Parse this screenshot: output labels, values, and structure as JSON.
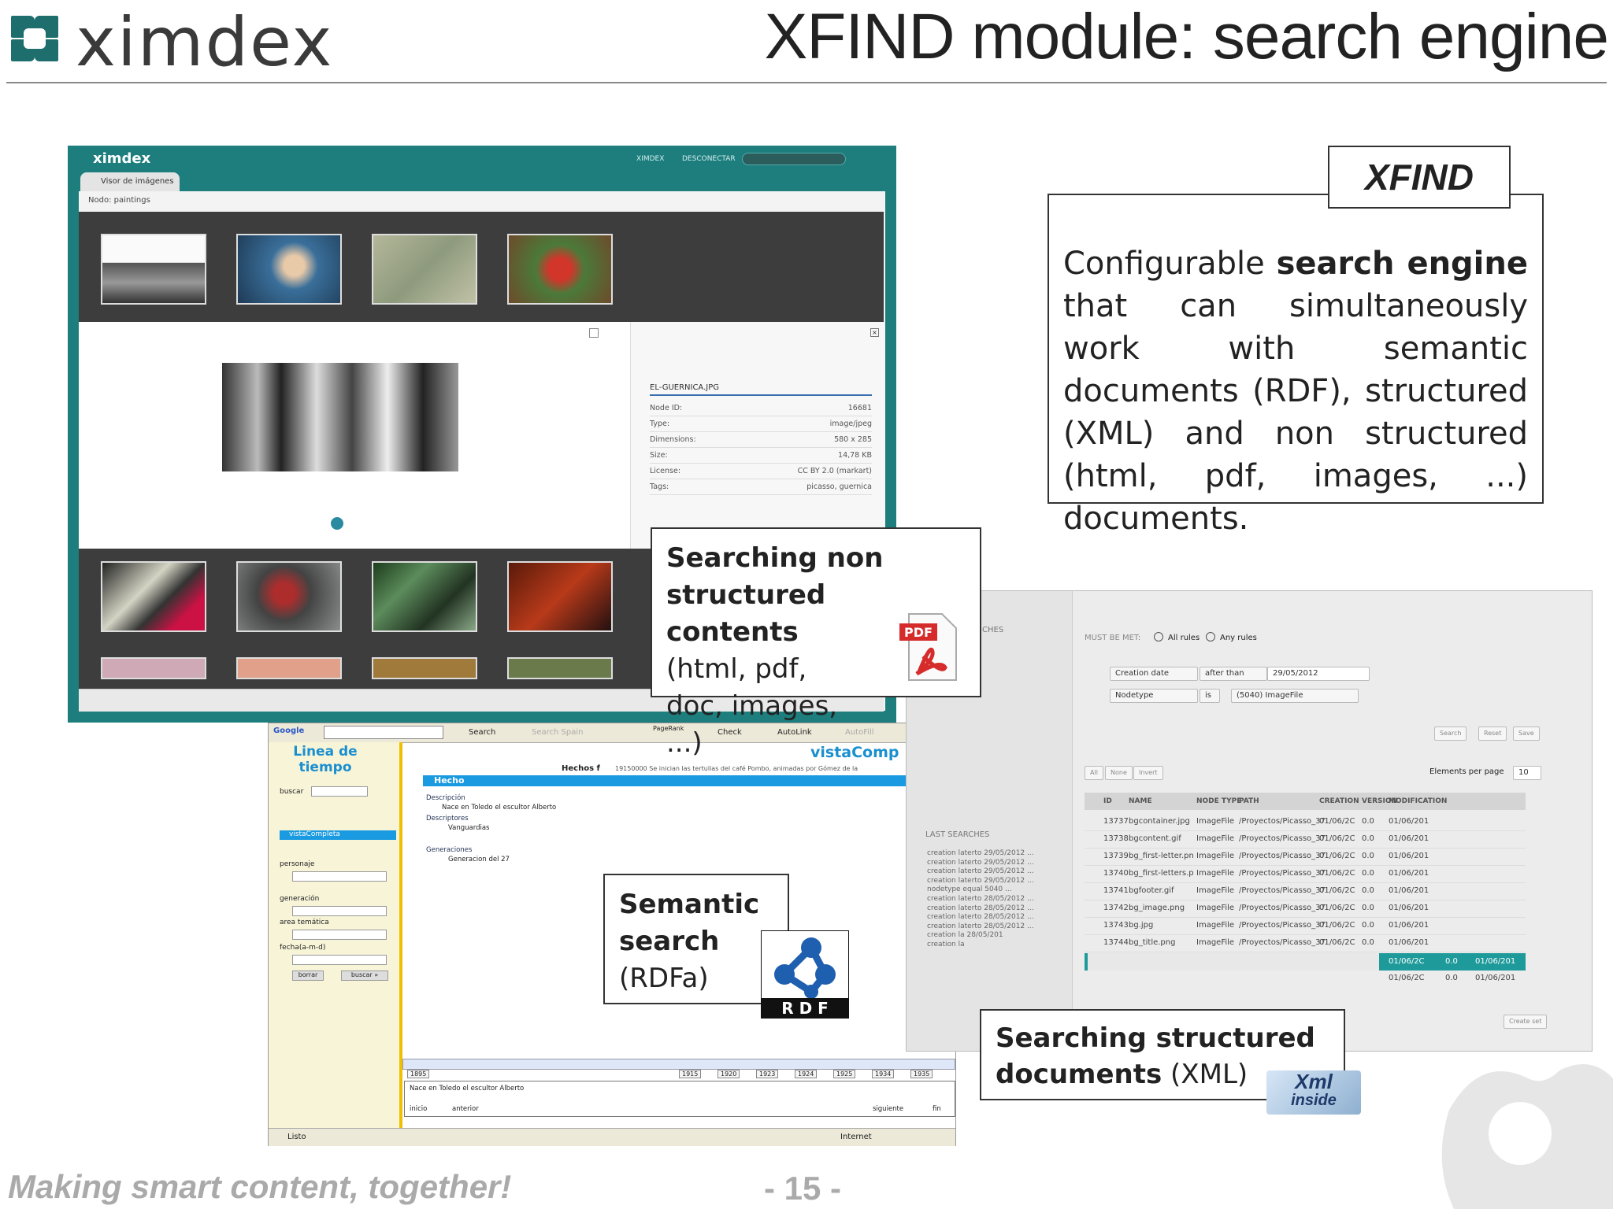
{
  "header": {
    "logo_text": "ximdex",
    "title": "XFIND module: search engine"
  },
  "footer": {
    "tagline": "Making smart content, together!",
    "page_number": "- 15 -"
  },
  "xfind": {
    "label": "XFIND",
    "text_before": "Configurable ",
    "text_bold": "search engine",
    "text_after": " that can simultaneously work with semantic documents (RDF), structured (XML) and non structured (html, pdf, images, ...) documents."
  },
  "callouts": {
    "nonstruct_title": "Searching non structured contents",
    "nonstruct_sub": "(html, pdf, doc, images, ...)",
    "pdf_badge": "PDF",
    "semantic_title": "Semantic search",
    "semantic_sub": "(RDFa)",
    "rdf_badge": "R D F",
    "structured_title": "Searching structured",
    "structured_sub_bold": "documents",
    "structured_sub": " (XML)",
    "xml_badge_1": "Xml",
    "xml_badge_2": "inside"
  },
  "viewer": {
    "brand": "ximdex",
    "user": "XIMDEX",
    "logout": "DESCONECTAR",
    "tab": "Visor de imágenes",
    "node_label": "Nodo: paintings",
    "file_name": "EL-GUERNICA.JPG",
    "info": [
      {
        "k": "Node ID:",
        "v": "16681"
      },
      {
        "k": "Type:",
        "v": "image/jpeg"
      },
      {
        "k": "Dimensions:",
        "v": "580 x 285"
      },
      {
        "k": "Size:",
        "v": "14,78 KB"
      },
      {
        "k": "License:",
        "v": "CC BY 2.0 (markart)"
      },
      {
        "k": "Tags:",
        "v": "picasso, guernica"
      }
    ]
  },
  "timeline": {
    "toolbar": [
      "Google",
      "Search",
      "Search Spain",
      "PageRank",
      "Check",
      "AutoLink",
      "AutoFill"
    ],
    "left_title": "Linea de tiempo",
    "buscar": "buscar",
    "vista_completa": "vistaCompleta",
    "personaje": "personaje",
    "generacion": "generación",
    "area_tematica": "area temática",
    "fecha": "fecha(a-m-d)",
    "borrar": "borrar",
    "buscar_btn": "buscar »",
    "app_title": "vistaComp",
    "hechos": "Hechos f",
    "hechos_text": "19150000 Se inician las tertulias del café Pombo, animadas por Gómez de la",
    "hecho_bar": "Hecho",
    "descripcion": "Descripción",
    "descripcion_text": "Nace en Toledo el escultor Alberto",
    "descriptores": "Descriptores",
    "descriptores_text": "Vanguardias",
    "generaciones": "Generaciones",
    "generaciones_text": "Generacion del 27",
    "years": [
      "1895",
      "1915",
      "1920",
      "1923",
      "1924",
      "1925",
      "1934",
      "1935"
    ],
    "event_text": "Nace en Toledo el escultor Alberto",
    "inicio": "inicio",
    "anterior": "anterior",
    "siguiente": "siguiente",
    "fin": "fin",
    "status_left": "Listo",
    "status_right": "Internet"
  },
  "search": {
    "side_header": "CHES",
    "must_be_met": "MUST BE MET:",
    "all_rules": "All rules",
    "any_rules": "Any rules",
    "rule1_field": "Creation date",
    "rule1_op": "after than",
    "rule1_value": "29/05/2012",
    "rule2_field": "Nodetype",
    "rule2_op": "is",
    "rule2_value": "(5040) ImageFile",
    "btn_search": "Search",
    "btn_reset": "Reset",
    "btn_save": "Save",
    "sel_all": "All",
    "sel_none": "None",
    "sel_invert": "Invert",
    "elements_per_page": "Elements per page",
    "per_page_value": "10",
    "last_searches_title": "LAST SEARCHES",
    "last_searches": [
      "creation laterto 29/05/2012 ...",
      "creation laterto 29/05/2012 ...",
      "creation laterto 29/05/2012 ...",
      "creation laterto 29/05/2012 ...",
      "nodetype equal 5040 ...",
      "creation laterto 28/05/2012 ...",
      "creation laterto 28/05/2012 ...",
      "creation laterto 28/05/2012 ...",
      "creation laterto 28/05/2012 ...",
      "creation la 28/05/201",
      "creation la"
    ],
    "columns": [
      "ID",
      "NAME",
      "NODE TYPE",
      "PATH",
      "CREATION",
      "VERSION",
      "MODIFICATION"
    ],
    "rows": [
      [
        "13737",
        "bgcontainer.jpg",
        "ImageFile",
        "/Proyectos/Picasso_37",
        "01/06/2C",
        "0.0",
        "01/06/201"
      ],
      [
        "13738",
        "bgcontent.gif",
        "ImageFile",
        "/Proyectos/Picasso_37",
        "01/06/2C",
        "0.0",
        "01/06/201"
      ],
      [
        "13739",
        "bg_first-letter.pn",
        "ImageFile",
        "/Proyectos/Picasso_37",
        "01/06/2C",
        "0.0",
        "01/06/201"
      ],
      [
        "13740",
        "bg_first-letters.p",
        "ImageFile",
        "/Proyectos/Picasso_37",
        "01/06/2C",
        "0.0",
        "01/06/201"
      ],
      [
        "13741",
        "bgfooter.gif",
        "ImageFile",
        "/Proyectos/Picasso_37",
        "01/06/2C",
        "0.0",
        "01/06/201"
      ],
      [
        "13742",
        "bg_image.png",
        "ImageFile",
        "/Proyectos/Picasso_37",
        "01/06/2C",
        "0.0",
        "01/06/201"
      ],
      [
        "13743",
        "bg.jpg",
        "ImageFile",
        "/Proyectos/Picasso_37",
        "01/06/2C",
        "0.0",
        "01/06/201"
      ],
      [
        "13744",
        "bg_title.png",
        "ImageFile",
        "/Proyectos/Picasso_37",
        "01/06/2C",
        "0.0",
        "01/06/201"
      ]
    ],
    "highlight_creation": "01/06/2C",
    "highlight_version": "0.0",
    "highlight_mod": "01/06/201",
    "last_row": [
      "01/06/2C",
      "0.0",
      "01/06/201"
    ],
    "create_set": "Create set"
  },
  "colors": {
    "teal": "#1e7e7e",
    "highlight": "#1e9a9a"
  }
}
